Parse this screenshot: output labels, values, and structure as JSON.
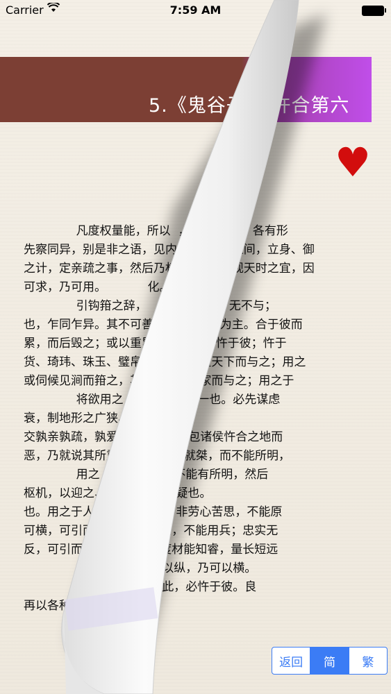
{
  "status": {
    "carrier": "Carrier",
    "time": "7:59 AM"
  },
  "chapter": {
    "title": "5.《鬼谷子》 忤合第六"
  },
  "body_lines": [
    "              凡度权量能，所以  ， 化转环属，各有形",
    "先察同异，别是非之语，见内  入居天地之间，立身、御",
    "之计，定亲疏之事，然后乃权  物之会，观天时之宜，因",
    "可求，乃可用。           化。",
    "              引钩箝之辞，   圣人无常与，无不与；",
    "也，乍同乍异。其不可善  计谋，与之为主。合于彼而",
    "累，而后毁之；或以重累    反于是，忤于彼；忤于",
    "货、琦玮、珠玉、璧帛      下，必量天下而与之；用之",
    "或伺候见涧而箝之，其      ，必量家而与之；用之于",
    "              将欲用之    进退，其用一也。必先谋虑",
    "衰，制地形之广狭、",
    "交孰亲孰疏，孰爱孰   协四海，包诸侯忤合之地而",
    "恶，乃就说其所重     就汤，五就桀，而不能所明，",
    "              用之    三入殷，而不能有所明，然后",
    "枢机，以迎之、      以归之不疑也。",
    "也。用之于人，      能御世；非劳心苦思，不能原",
    "可横，可引而        材质不惠，不能用兵；忠实无",
    "反，可引而覆        己必自度材能知睿，量长短远",
    "                  可以退，乃可以纵，乃可以横。",
    "",
    "                  ，相向。合于此，必忤于彼。良",
    "",
    "再以各种"
  ],
  "segment": {
    "back": "返回",
    "simplified": "简",
    "traditional": "繁"
  },
  "icons": {
    "heart": "heart-icon",
    "wifi": "wifi-icon",
    "battery": "battery-icon"
  },
  "colors": {
    "accent": "#3b7cf5",
    "band_brown": "#7c3f34",
    "band_purple": "#c04ee9",
    "heart": "#d20d0d"
  }
}
